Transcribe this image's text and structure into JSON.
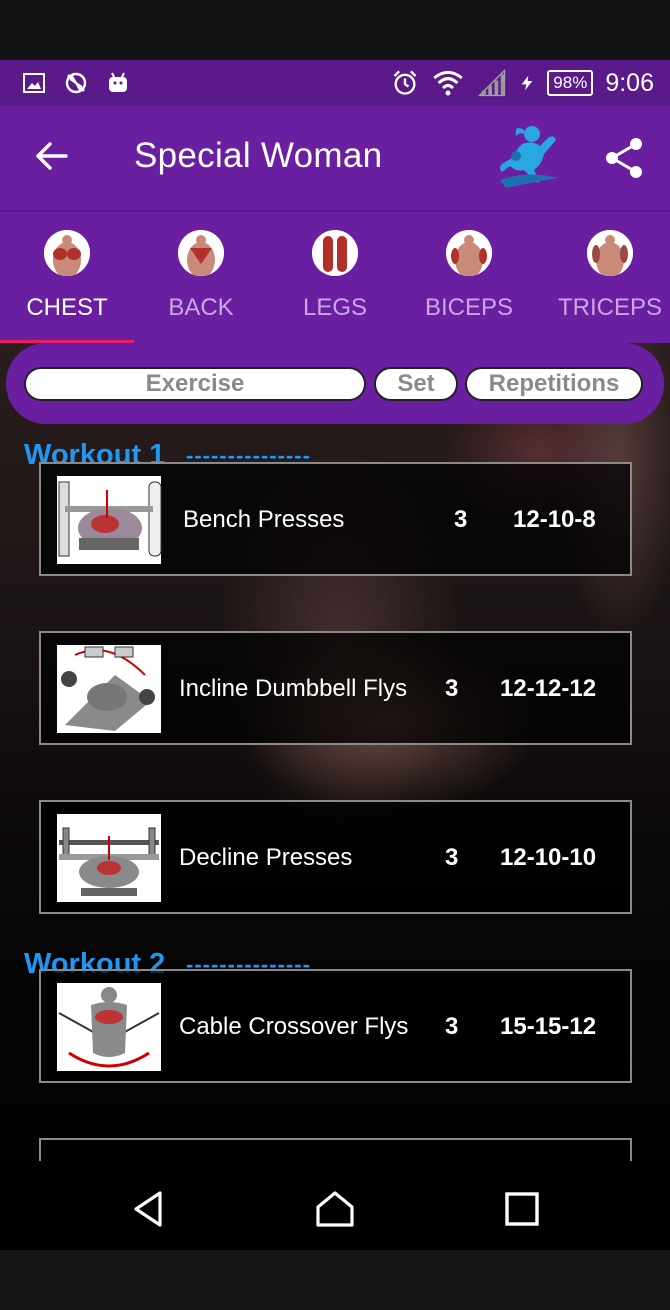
{
  "status_bar": {
    "time": "9:06",
    "battery": "98%",
    "icons": [
      "image-icon",
      "no-sync-icon",
      "android-icon",
      "alarm-icon",
      "wifi-icon",
      "signal-icon",
      "charging-icon"
    ]
  },
  "app_bar": {
    "title": "Special Woman",
    "back_icon": "arrow-left-icon",
    "logo_icon": "woman-fitness-logo",
    "share_icon": "share-icon"
  },
  "tabs": [
    {
      "label": "CHEST",
      "active": true
    },
    {
      "label": "BACK",
      "active": false
    },
    {
      "label": "LEGS",
      "active": false
    },
    {
      "label": "BICEPS",
      "active": false
    },
    {
      "label": "TRICEPS",
      "active": false
    }
  ],
  "table_header": {
    "exercise": "Exercise",
    "set": "Set",
    "repetitions": "Repetitions"
  },
  "workouts": [
    {
      "title": "Workout 1",
      "dashes": "---------------",
      "exercises": [
        {
          "name": "Bench Presses",
          "set": "3",
          "reps": "12-10-8"
        },
        {
          "name": "Incline Dumbbell Flys",
          "set": "3",
          "reps": "12-12-12"
        },
        {
          "name": "Decline Presses",
          "set": "3",
          "reps": "12-10-10"
        }
      ]
    },
    {
      "title": "Workout 2",
      "dashes": "---------------",
      "exercises": [
        {
          "name": "Cable Crossover Flys",
          "set": "3",
          "reps": "15-15-12"
        }
      ]
    }
  ],
  "nav_bar": {
    "back_icon": "nav-back-icon",
    "home_icon": "nav-home-icon",
    "recents_icon": "nav-recents-icon"
  },
  "colors": {
    "primary": "#6a1fa0",
    "status_bar": "#5b1a8a",
    "accent": "#e91e63",
    "workout_title": "#2196f3"
  }
}
